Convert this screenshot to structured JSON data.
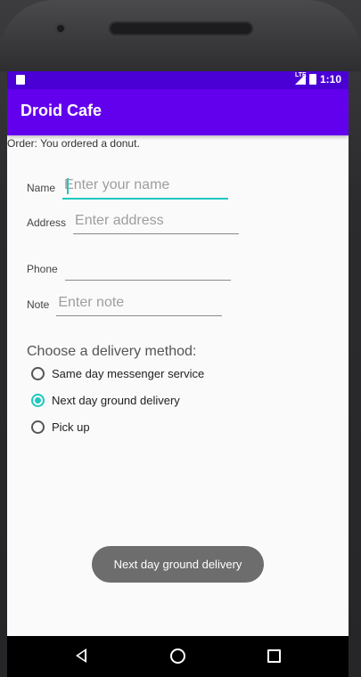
{
  "status_bar": {
    "network_label": "LTE",
    "time": "1:10"
  },
  "app_bar": {
    "title": "Droid Cafe"
  },
  "order": {
    "text": "Order: You ordered a donut."
  },
  "form": {
    "name": {
      "label": "Name",
      "value": "",
      "placeholder": "Enter your name"
    },
    "address": {
      "label": "Address",
      "value": "",
      "placeholder": "Enter address"
    },
    "phone": {
      "label": "Phone",
      "value": "",
      "placeholder": ""
    },
    "note": {
      "label": "Note",
      "value": "",
      "placeholder": "Enter note"
    }
  },
  "delivery": {
    "heading": "Choose a delivery method:",
    "options": [
      {
        "label": "Same day messenger service",
        "checked": false
      },
      {
        "label": "Next day ground delivery",
        "checked": true
      },
      {
        "label": "Pick up",
        "checked": false
      }
    ]
  },
  "toast": {
    "text": "Next day ground delivery"
  },
  "colors": {
    "status_bar": "#4a00d4",
    "app_bar": "#6200ee",
    "accent": "#1ec8c0",
    "toast_bg": "#6d6d6d"
  },
  "icons": {
    "status_left": "sd-card-icon",
    "signal": "signal-icon",
    "battery": "battery-icon",
    "nav_back": "back-icon",
    "nav_home": "home-icon",
    "nav_recent": "recent-apps-icon"
  }
}
